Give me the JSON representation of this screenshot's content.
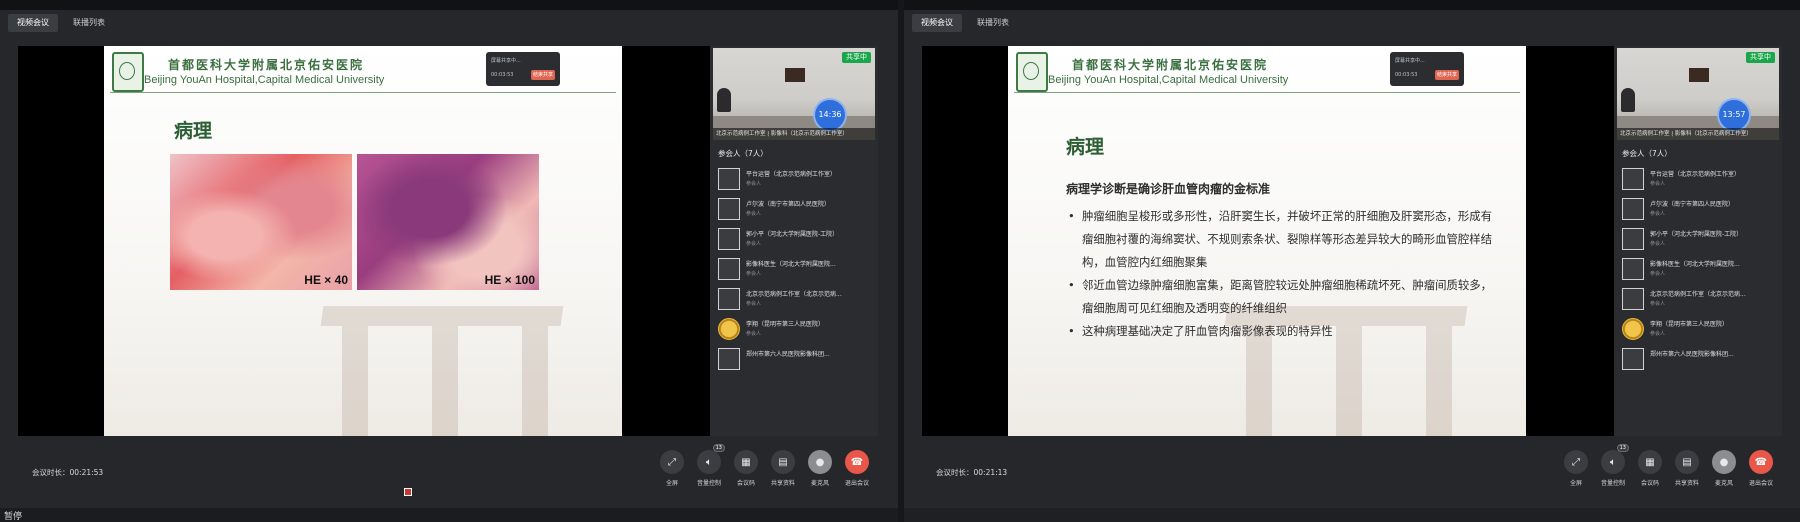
{
  "panels": [
    {
      "tabs": [
        "视频会议",
        "联播列表"
      ],
      "hospital_cn": "首都医科大学附属北京佑安医院",
      "hospital_en": "Beijing YouAn Hospital,Capital Medical University",
      "timer_label": "屏幕共享中...",
      "timer_value": "00:03:53",
      "timer_button": "结束共享",
      "slide_title": "病理",
      "image_labels": [
        "HE × 40",
        "HE × 100"
      ],
      "share_badge": "共享中",
      "clock": "14:36",
      "video_caption": "北京示范病例工作室 | 影像科（北京示范病例工作室）",
      "participants_header": "参会人（7人）",
      "duration": "会议时长：00:21:53",
      "volume_badge": "13"
    },
    {
      "tabs": [
        "视频会议",
        "联播列表"
      ],
      "hospital_cn": "首都医科大学附属北京佑安医院",
      "hospital_en": "Beijing YouAn Hospital,Capital Medical University",
      "timer_label": "屏幕共享中...",
      "timer_value": "00:03:53",
      "timer_button": "结束共享",
      "slide_title": "病理",
      "heading": "病理学诊断是确诊肝血管肉瘤的金标准",
      "bullets": [
        "肿瘤细胞呈梭形或多形性，沿肝窦生长，并破坏正常的肝细胞及肝窦形态，形成有瘤细胞衬覆的海绵窦状、不规则索条状、裂隙样等形态差异较大的畸形血管腔样结构，血管腔内红细胞聚集",
        "邻近血管边缘肿瘤细胞富集，距离管腔较远处肿瘤细胞稀疏坏死、肿瘤间质较多，瘤细胞周可见红细胞及透明变的纤维组织",
        "这种病理基础决定了肝血管肉瘤影像表现的特异性"
      ],
      "share_badge": "共享中",
      "clock": "13:57",
      "video_caption": "北京示范病例工作室 | 影像科（北京示范病例工作室）",
      "participants_header": "参会人（7人）",
      "duration": "会议时长：00:21:13",
      "volume_badge": "13"
    }
  ],
  "participants": [
    {
      "name": "平台运营（北京示范病例工作室）",
      "role": "参会人"
    },
    {
      "name": "卢尔波（南宁市第四人民医院）",
      "role": "参会人"
    },
    {
      "name": "郭小平（河北大学附属医院-工院）",
      "role": "参会人"
    },
    {
      "name": "影像科医生（河北大学附属医院...",
      "role": "参会人"
    },
    {
      "name": "北京示范病例工作室（北京示范病...",
      "role": "参会人"
    },
    {
      "name": "李翔（昆明市第三人民医院）",
      "role": "参会人"
    },
    {
      "name": "郑州市第六人民医院影像科团...",
      "role": ""
    }
  ],
  "controls": [
    "全屏",
    "音量控制",
    "会议码",
    "共享资料",
    "麦克风",
    "退出会议"
  ],
  "status_text": "暂停",
  "colors": {
    "share_green": "#1aa64a",
    "clock_blue": "#2f6fdc",
    "leave_red": "#e8574a",
    "title_green": "#2c5e34"
  }
}
